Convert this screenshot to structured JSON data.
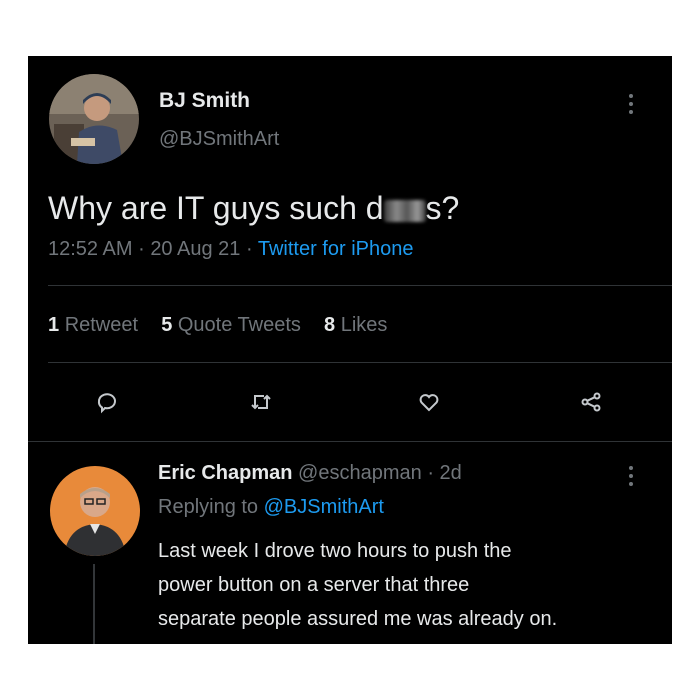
{
  "tweet": {
    "author_name": "BJ Smith",
    "handle": "@BJSmithArt",
    "text_before": "Why are IT guys such d",
    "text_after": "s?",
    "time": "12:52 AM",
    "date": "20 Aug 21",
    "separator": "·",
    "source": "Twitter for iPhone",
    "stats": {
      "retweets_count": "1",
      "retweets_label": "Retweet",
      "quotes_count": "5",
      "quotes_label": "Quote Tweets",
      "likes_count": "8",
      "likes_label": "Likes"
    },
    "icons": [
      "more-icon",
      "reply-icon",
      "retweet-icon",
      "like-icon",
      "share-icon"
    ]
  },
  "reply": {
    "author_name": "Eric Chapman",
    "handle": "@eschapman",
    "age": "· 2d",
    "replying_prefix": "Replying to",
    "replying_handle": "@BJSmithArt",
    "text_line1": "Last week I drove two hours to push the",
    "text_line2": "power button on a server that three",
    "text_line3": "separate people assured me was already on."
  },
  "colors": {
    "background": "#000000",
    "text": "#e7e9ea",
    "muted": "#71767b",
    "link": "#1d9bf0",
    "divider": "#2f3336",
    "page": "#ffffff"
  }
}
